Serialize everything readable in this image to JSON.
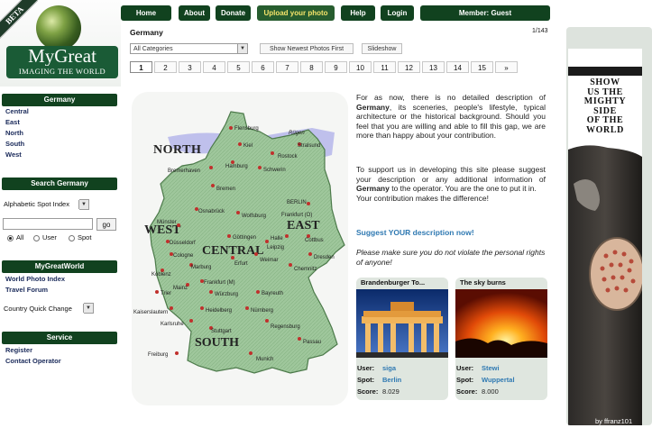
{
  "logo": {
    "badge": "BETA",
    "title": "MyGreat",
    "subtitle": "IMAGING THE WORLD"
  },
  "nav": {
    "home": "Home",
    "about": "About",
    "donate": "Donate",
    "upload": "Upload your photo",
    "help": "Help",
    "login": "Login",
    "member": "Member: Guest"
  },
  "header": {
    "title": "Germany",
    "counter": "1/143",
    "category_select": "All Categories",
    "newest_button": "Show Newest Photos First",
    "slideshow_button": "Slideshow"
  },
  "pager": [
    "1",
    "2",
    "3",
    "4",
    "5",
    "6",
    "7",
    "8",
    "9",
    "10",
    "11",
    "12",
    "13",
    "14",
    "15",
    "»"
  ],
  "pager_active": "1",
  "sidebar": {
    "germany_title": "Germany",
    "regions": [
      "Central",
      "East",
      "North",
      "South",
      "West"
    ],
    "search_title": "Search Germany",
    "spot_index": "Alphabetic Spot Index",
    "search_value": "",
    "go": "go",
    "radio_all": "All",
    "radio_user": "User",
    "radio_spot": "Spot",
    "world_title": "MyGreatWorld",
    "world_links": [
      "World Photo Index",
      "Travel Forum"
    ],
    "country_change": "Country Quick Change",
    "service_title": "Service",
    "service_links": [
      "Register",
      "Contact Operator"
    ]
  },
  "map": {
    "regions": {
      "north": "NORTH",
      "west": "WEST",
      "central": "CENTRAL",
      "east": "EAST",
      "south": "SOUTH"
    },
    "cities": {
      "flensburg": "Flensburg",
      "ruegen": "Rügen",
      "stralsund": "Stralsund",
      "kiel": "Kiel",
      "rostock": "Rostock",
      "hamburg": "Hamburg",
      "schwerin": "Schwerin",
      "bremerhaven": "Bremerhaven",
      "bremen": "Bremen",
      "berlin": "BERLIN",
      "frankfurt_oder": "Frankfurt (O)",
      "osnabrueck": "Osnabrück",
      "wolfsburg": "Wolfsburg",
      "halle": "Halle",
      "cottbus": "Cottbus",
      "muenster": "Münster",
      "duesseldorf": "Düsseldorf",
      "goettingen": "Göttingen",
      "leipzig": "Leipzig",
      "cologne": "Cologne",
      "erfurt": "Erfurt",
      "weimar": "Weimar",
      "dresden": "Dresden",
      "marburg": "Marburg",
      "chemnitz": "Chemnitz",
      "koblenz": "Koblenz",
      "frankfurt": "Frankfurt (M)",
      "mainz": "Mainz",
      "trier": "Trier",
      "bayreuth": "Bayreuth",
      "wuerzburg": "Würzburg",
      "kaiserslautern": "Kaiserslautern",
      "heidelberg": "Heidelberg",
      "nuernberg": "Nürnberg",
      "karlsruhe": "Karlsruhe",
      "regensburg": "Regensburg",
      "stuttgart": "Stuttgart",
      "passau": "Passau",
      "freiburg": "Freiburg",
      "munich": "Munich"
    }
  },
  "description": {
    "p1_a": "For as now, there is no detailed description of ",
    "p1_country": "Germany",
    "p1_b": ", its sceneries, people's lifestyle, typical architecture or the historical background. Should you feel that you are willing and able to fill this gap, we are more than happy about your contribution.",
    "p2_a": "To support us in developing this site please suggest your description or any additional information of ",
    "p2_country": "Germany",
    "p2_b": " to the operator. You are the one to put it in.",
    "p3": "Your contribution makes the difference!",
    "suggest": "Suggest YOUR description now!",
    "note": "Please make sure you do not violate the personal rights of anyone!"
  },
  "cards": [
    {
      "title": "Brandenburger To...",
      "user_label": "User:",
      "user": "siga",
      "spot_label": "Spot:",
      "spot": "Berlin",
      "score_label": "Score:",
      "score": "8.029"
    },
    {
      "title": "The sky burns",
      "user_label": "User:",
      "user": "Stewi",
      "spot_label": "Spot:",
      "spot": "Wuppertal",
      "score_label": "Score:",
      "score": "8.000"
    }
  ],
  "banner": {
    "line1": "SHOW",
    "line2": "US THE",
    "line3": "MIGHTY",
    "line4": "SIDE",
    "line5": "OF THE",
    "line6": "WORLD",
    "credit": "by ffranz101"
  },
  "colors": {
    "nav_green": "#11421f",
    "link_blue": "#2f79b2",
    "logo_green": "#1a5b36",
    "upload_text": "#f5e46a"
  }
}
